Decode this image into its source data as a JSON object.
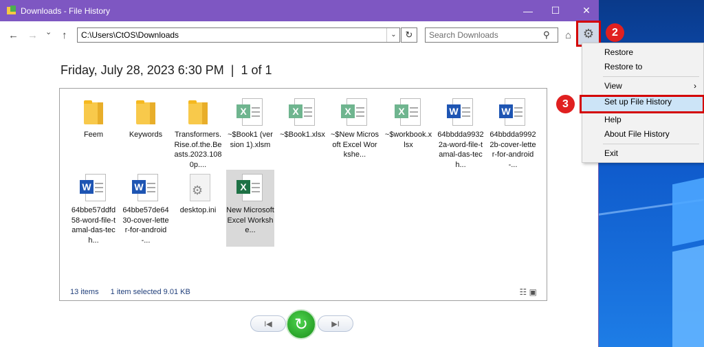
{
  "window": {
    "title": "Downloads - File History",
    "minimize": "—",
    "maximize": "☐",
    "close": "✕"
  },
  "toolbar": {
    "back": "←",
    "forward": "→",
    "recent": "⌄",
    "up": "↑",
    "address": "C:\\Users\\CtOS\\Downloads",
    "address_dropdown": "⌄",
    "refresh": "↻",
    "search_placeholder": "Search Downloads",
    "search_icon": "⚲",
    "home_icon": "⌂",
    "settings_icon": "⚙"
  },
  "badges": {
    "step2": "2",
    "step3": "3"
  },
  "heading": {
    "date": "Friday, July 28, 2023 6:30 PM",
    "separator": "|",
    "position": "1 of 1"
  },
  "files": [
    {
      "name": "Feem",
      "icon": "folder"
    },
    {
      "name": "Keywords",
      "icon": "folder"
    },
    {
      "name": "Transformers.Rise.of.the.Beasts.2023.1080p....",
      "icon": "folder"
    },
    {
      "name": "~$Book1 (version 1).xlsm",
      "icon": "excel-macro"
    },
    {
      "name": "~$Book1.xlsx",
      "icon": "excel"
    },
    {
      "name": "~$New Microsoft Excel Workshe...",
      "icon": "excel"
    },
    {
      "name": "~$workbook.xlsx",
      "icon": "excel"
    },
    {
      "name": "64bbdda99322a-word-file-tamal-das-tech...",
      "icon": "word"
    },
    {
      "name": "64bbdda99922b-cover-letter-for-android-...",
      "icon": "word"
    },
    {
      "name": "64bbe57ddfd58-word-file-tamal-das-tech...",
      "icon": "word"
    },
    {
      "name": "64bbe57de6430-cover-letter-for-android-...",
      "icon": "word"
    },
    {
      "name": "desktop.ini",
      "icon": "settings-file"
    },
    {
      "name": "New Microsoft Excel Workshe...",
      "icon": "excel",
      "selected": true
    }
  ],
  "status": {
    "items": "13 items",
    "selection": "1 item selected  9.01 KB"
  },
  "playback": {
    "previous": "I◀",
    "next": "▶I",
    "restore": "↻"
  },
  "menu": {
    "items": [
      {
        "label": "Restore"
      },
      {
        "label": "Restore to"
      },
      {
        "label": "View",
        "submenu": "›"
      },
      {
        "label": "Set up File History",
        "highlighted": true
      },
      {
        "label": "Help"
      },
      {
        "label": "About File History"
      },
      {
        "label": "Exit"
      }
    ]
  },
  "colors": {
    "titlebar": "#7e57c2",
    "annotation_red": "#d40000",
    "menu_highlight": "#cce4f7"
  }
}
